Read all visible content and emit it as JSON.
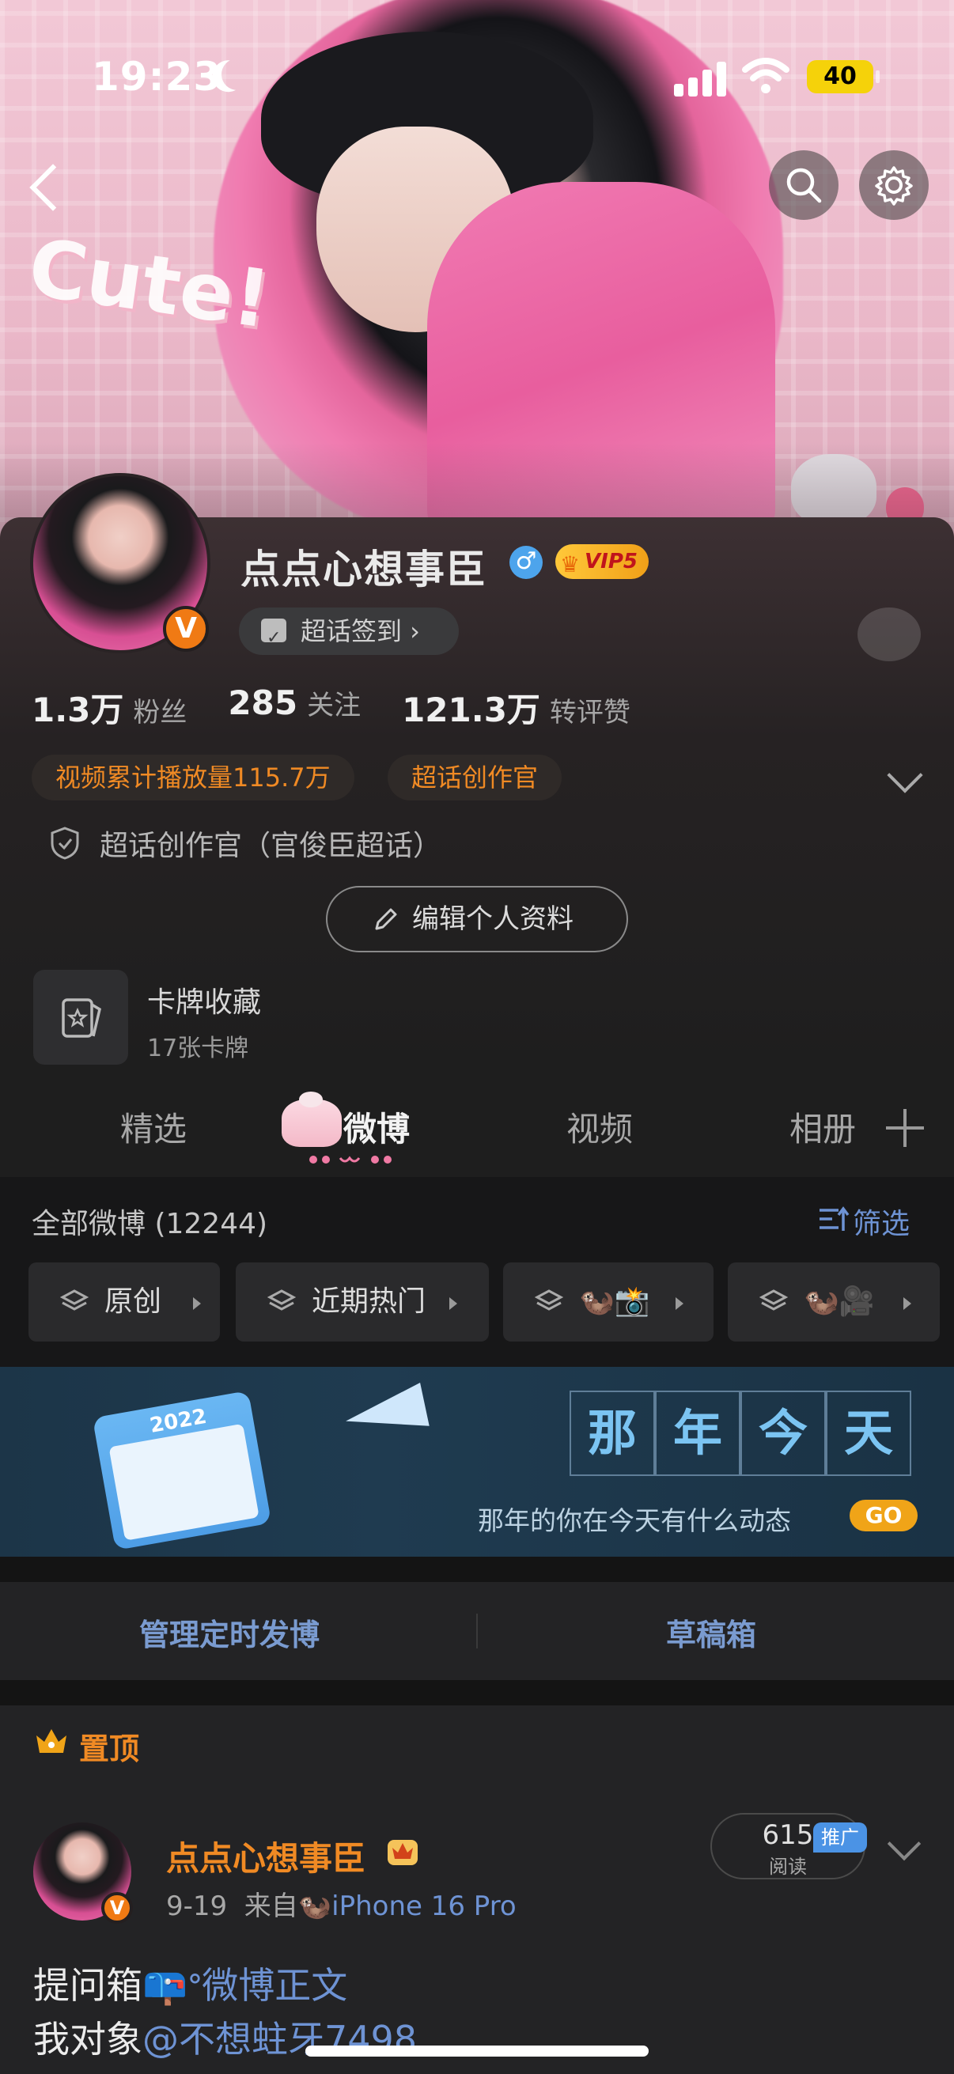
{
  "status_bar": {
    "time": "19:23",
    "battery": "40"
  },
  "profile": {
    "username": "点点心想事臣",
    "gender_symbol": "♂",
    "vip_label": "VIP5",
    "verified_badge": "V",
    "checkin_label": "超话签到 ›",
    "stats": [
      {
        "value": "1.3万",
        "label": "粉丝"
      },
      {
        "value": "285",
        "label": "关注"
      },
      {
        "value": "121.3万",
        "label": "转评赞"
      }
    ],
    "tags": [
      "视频累计播放量115.7万",
      "超话创作官"
    ],
    "creator_line": "超话创作官（官俊臣超话）",
    "edit_button": "编辑个人资料",
    "card": {
      "title": "卡牌收藏",
      "subtitle": "17张卡牌"
    }
  },
  "tabs": [
    {
      "label": "精选",
      "active": false
    },
    {
      "label": "微博",
      "active": true
    },
    {
      "label": "视频",
      "active": false
    },
    {
      "label": "相册",
      "active": false
    }
  ],
  "feed_header": {
    "all_count": "全部微博 (12244)",
    "filter_label": "筛选",
    "chips": [
      "原创",
      "近期热门",
      "🦦📸",
      "🦦🎥"
    ]
  },
  "banner": {
    "calendar_year": "2022",
    "chars": [
      "那",
      "年",
      "今",
      "天"
    ],
    "text": "那年的你在今天有什么动态",
    "go_label": "GO"
  },
  "manage": {
    "scheduled": "管理定时发博",
    "drafts": "草稿箱"
  },
  "pinned": {
    "pin_label": "置顶",
    "author": "点点心想事臣",
    "date": "9-19",
    "source_prefix": "来自",
    "source_emoji": "🦦",
    "device": "iPhone 16 Pro",
    "views_count": "615",
    "views_label": "阅读",
    "promo_label": "推广",
    "line1_prefix": "提问箱📪",
    "line1_link": "微博正文",
    "line2_prefix": "我对象",
    "line2_link": "@不想蛀牙7498"
  },
  "icons": [
    "back-icon",
    "search-icon",
    "gear-icon",
    "calendar-check-icon",
    "shield-icon",
    "pencil-icon",
    "card-icon",
    "layers-icon",
    "filter-icon",
    "crown-icon",
    "chevron-down-icon",
    "plus-icon"
  ],
  "colors": {
    "accent_orange": "#f08a24",
    "link_blue": "#6e93d4",
    "vip_gold": "#ffc83a",
    "background": "#1e1e1e"
  }
}
